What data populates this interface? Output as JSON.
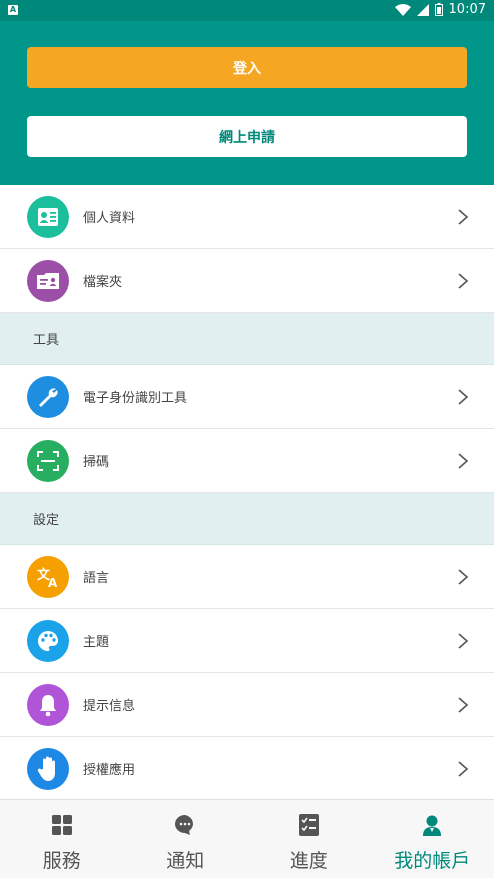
{
  "status_bar": {
    "time": "10:07",
    "badge": "A"
  },
  "header": {
    "login_label": "登入",
    "apply_label": "網上申請"
  },
  "rows_top": [
    {
      "label": "個人資料",
      "icon": "profile-card-icon",
      "color": "#1bbf9b"
    },
    {
      "label": "檔案夾",
      "icon": "folder-icon",
      "color": "#9b4fa6"
    }
  ],
  "section_tools": {
    "title": "工具"
  },
  "rows_tools": [
    {
      "label": "電子身份識別工具",
      "icon": "wrench-icon",
      "color": "#1e8fe0"
    },
    {
      "label": "掃碼",
      "icon": "scan-icon",
      "color": "#27ae60"
    }
  ],
  "section_settings": {
    "title": "設定"
  },
  "rows_settings": [
    {
      "label": "語言",
      "icon": "translate-icon",
      "color": "#f5a000"
    },
    {
      "label": "主題",
      "icon": "palette-icon",
      "color": "#1aa3e8"
    },
    {
      "label": "提示信息",
      "icon": "bell-icon",
      "color": "#b055d8"
    },
    {
      "label": "授權應用",
      "icon": "hand-icon",
      "color": "#1e88e5"
    }
  ],
  "tabs": [
    {
      "label": "服務",
      "icon": "grid-icon",
      "active": false
    },
    {
      "label": "通知",
      "icon": "chat-icon",
      "active": false
    },
    {
      "label": "進度",
      "icon": "checklist-icon",
      "active": false
    },
    {
      "label": "我的帳戶",
      "icon": "account-icon",
      "active": true
    }
  ],
  "colors": {
    "primary": "#00968a",
    "accent": "#f5a623"
  }
}
